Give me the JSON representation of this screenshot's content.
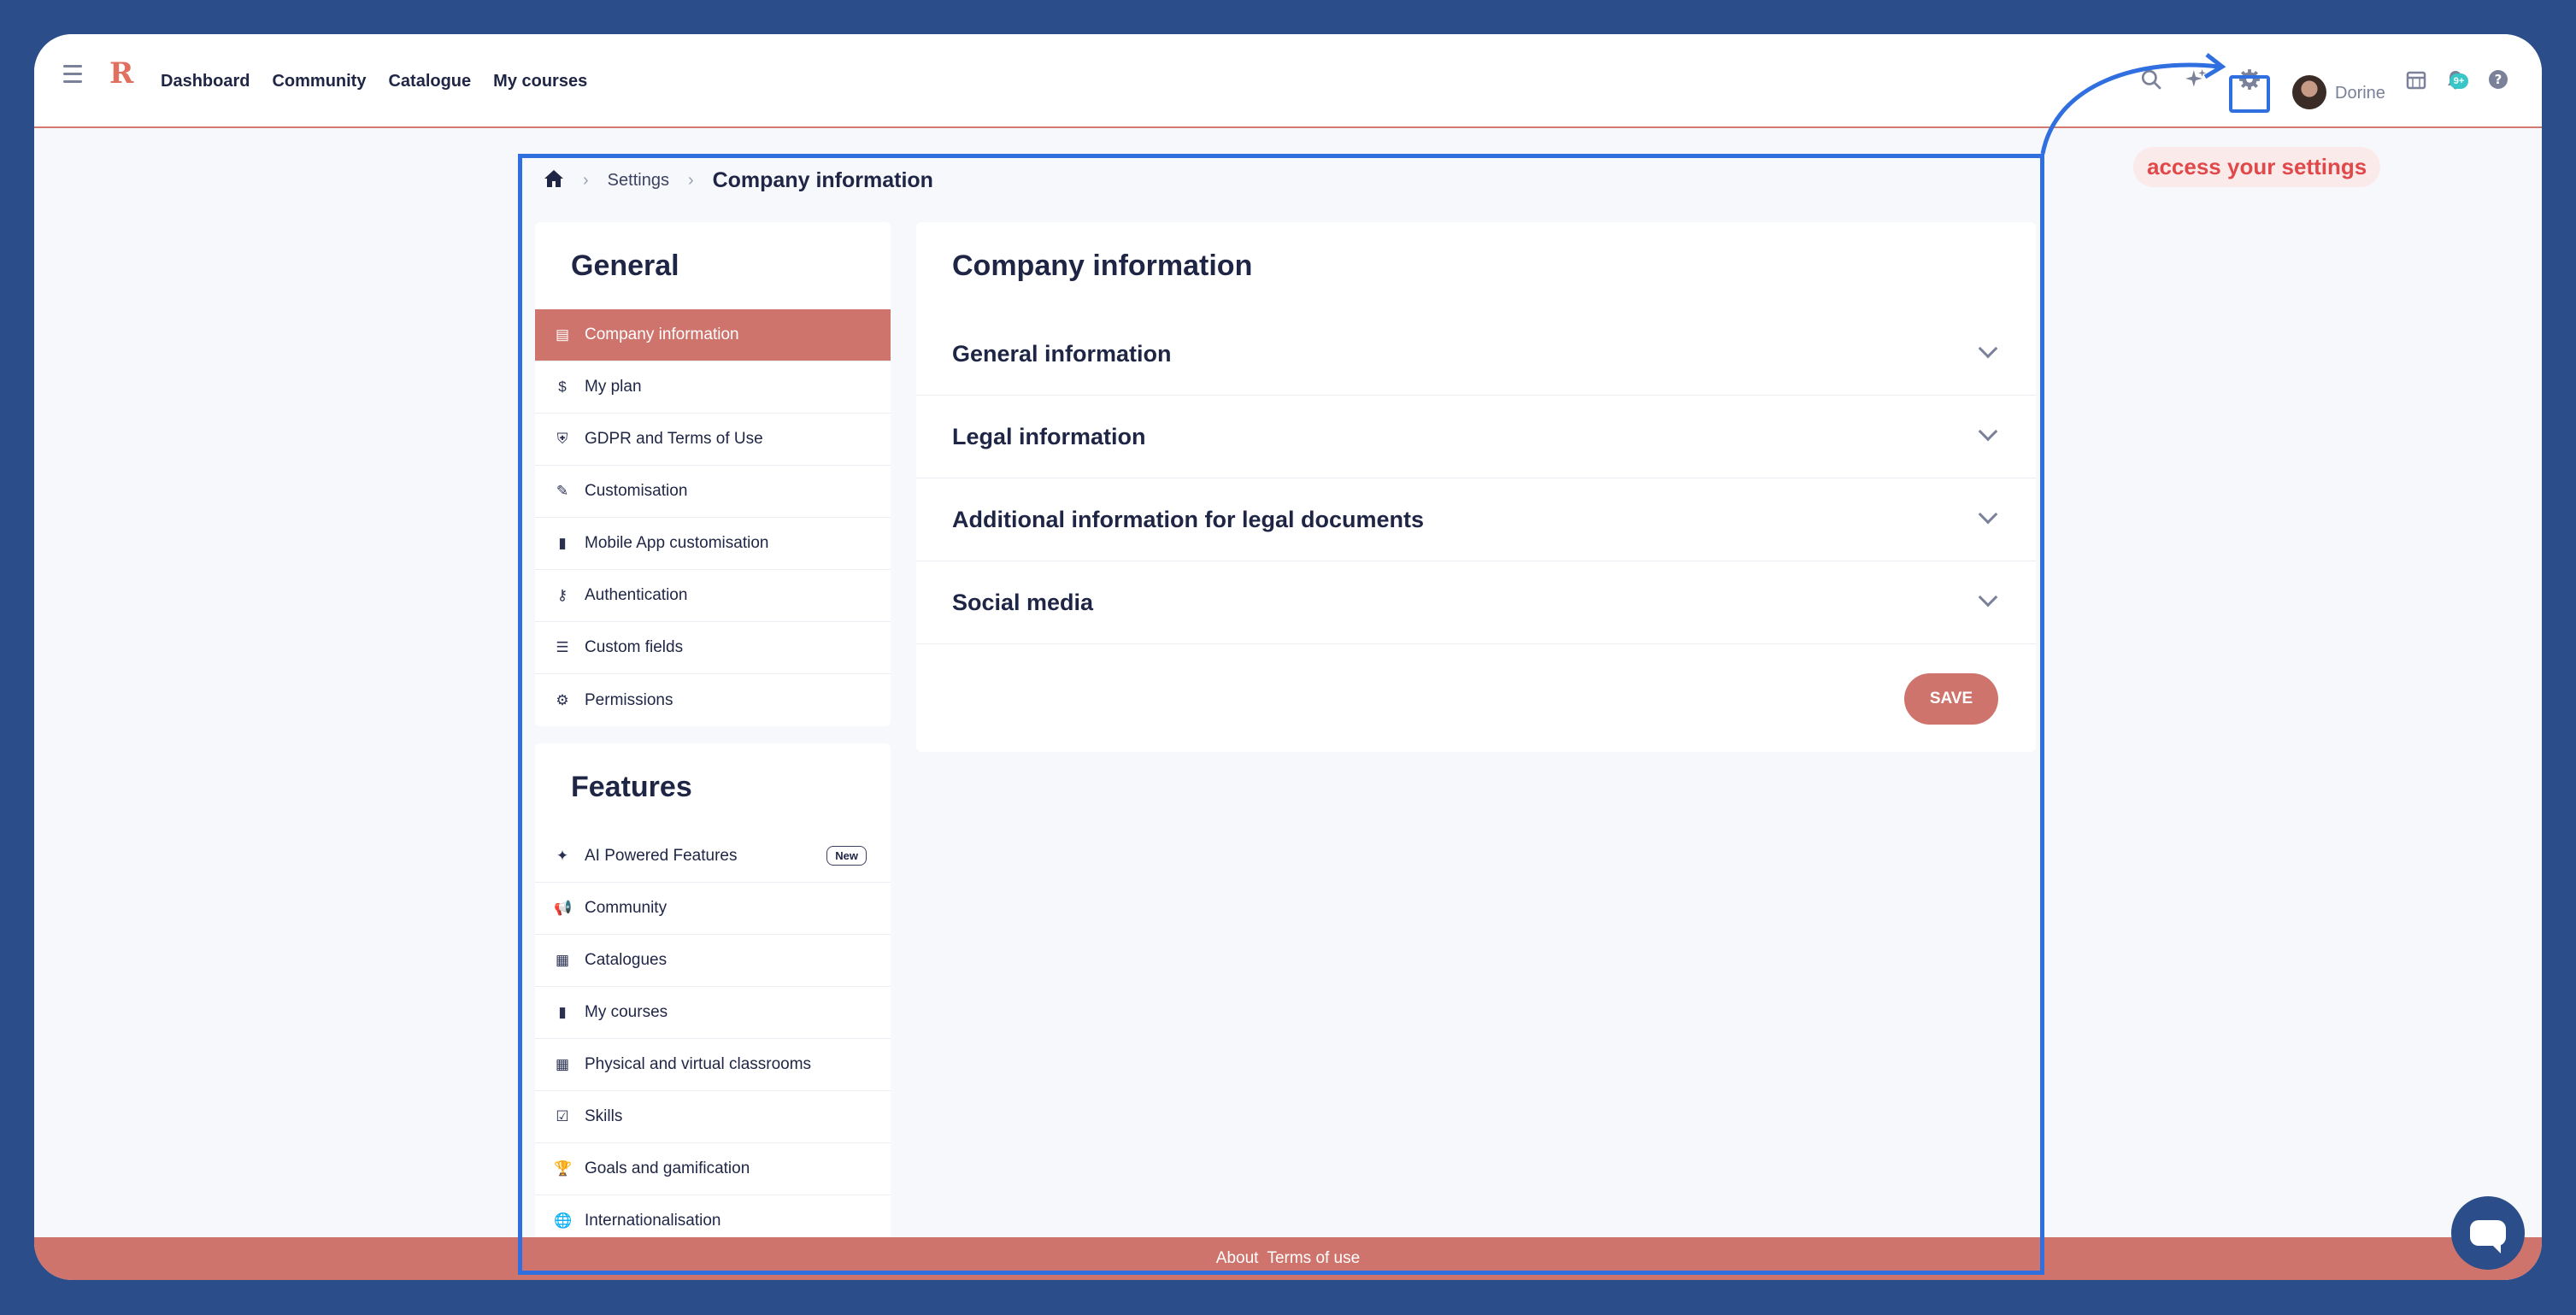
{
  "topbar": {
    "logo": "R",
    "nav": [
      "Dashboard",
      "Community",
      "Catalogue",
      "My courses"
    ],
    "username": "Dorine",
    "notification_badge": "9+",
    "icons": [
      "search-icon",
      "ai-sparkle-icon",
      "gear-icon",
      "calendar-icon",
      "bell-icon",
      "help-icon"
    ]
  },
  "callout": {
    "text": "access your settings",
    "color": "#e0484a"
  },
  "breadcrumb": {
    "crumbs": [
      "Settings"
    ],
    "current": "Company information"
  },
  "sidebar": {
    "general": {
      "title": "General",
      "items": [
        {
          "label": "Company information",
          "icon": "▤",
          "active": true
        },
        {
          "label": "My plan",
          "icon": "$"
        },
        {
          "label": "GDPR and Terms of Use",
          "icon": "⛨"
        },
        {
          "label": "Customisation",
          "icon": "✎"
        },
        {
          "label": "Mobile App customisation",
          "icon": "▮"
        },
        {
          "label": "Authentication",
          "icon": "⚷"
        },
        {
          "label": "Custom fields",
          "icon": "☰"
        },
        {
          "label": "Permissions",
          "icon": "⚙"
        }
      ]
    },
    "features": {
      "title": "Features",
      "items": [
        {
          "label": "AI Powered Features",
          "icon": "✦",
          "badge": "New"
        },
        {
          "label": "Community",
          "icon": "📢"
        },
        {
          "label": "Catalogues",
          "icon": "▦"
        },
        {
          "label": "My courses",
          "icon": "▮"
        },
        {
          "label": "Physical and virtual classrooms",
          "icon": "▦"
        },
        {
          "label": "Skills",
          "icon": "☑"
        },
        {
          "label": "Goals and gamification",
          "icon": "🏆"
        },
        {
          "label": "Internationalisation",
          "icon": "🌐"
        }
      ]
    }
  },
  "main": {
    "title": "Company information",
    "sections": [
      "General information",
      "Legal information",
      "Additional information for legal documents",
      "Social media"
    ],
    "save_label": "SAVE"
  },
  "footer": {
    "about": "About",
    "terms": "Terms of use"
  },
  "colors": {
    "accent": "#ce746c",
    "highlight": "#2f6fe0",
    "background": "#2b4e8a"
  }
}
